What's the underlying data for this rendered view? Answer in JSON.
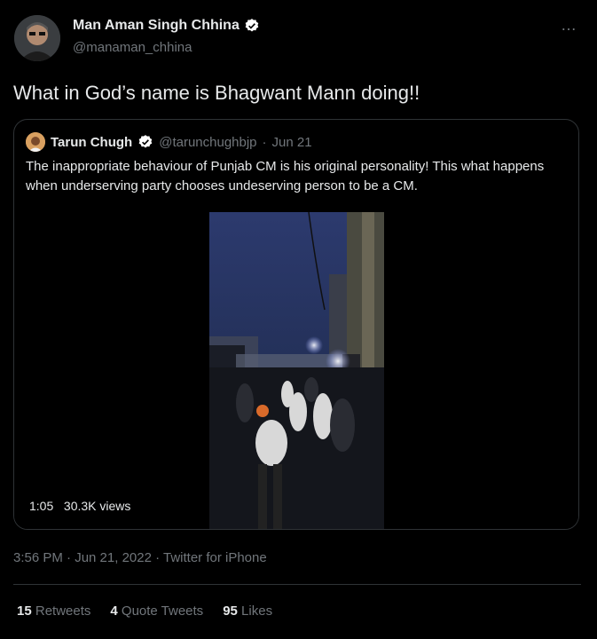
{
  "author": {
    "name": "Man Aman Singh Chhina",
    "handle": "@manaman_chhina"
  },
  "more_icon": "…",
  "tweet_text": "What in God’s name is Bhagwant Mann doing!!",
  "quoted": {
    "name": "Tarun Chugh",
    "handle": "@tarunchughbjp",
    "separator": "·",
    "date": "Jun 21",
    "text": "The inappropriate behaviour of Punjab CM is his original personality! This what happens when underserving party chooses undeserving person to be a CM.",
    "video": {
      "duration": "1:05",
      "views": "30.3K views"
    }
  },
  "timestamp": "3:56 PM · Jun 21, 2022 · Twitter for iPhone",
  "stats": {
    "retweets": {
      "count": "15",
      "label": "Retweets"
    },
    "quotes": {
      "count": "4",
      "label": "Quote Tweets"
    },
    "likes": {
      "count": "95",
      "label": "Likes"
    }
  },
  "colors": {
    "background": "#000000",
    "text": "#e7e9ea",
    "secondary": "#71767b",
    "verified": "#ffffff"
  }
}
